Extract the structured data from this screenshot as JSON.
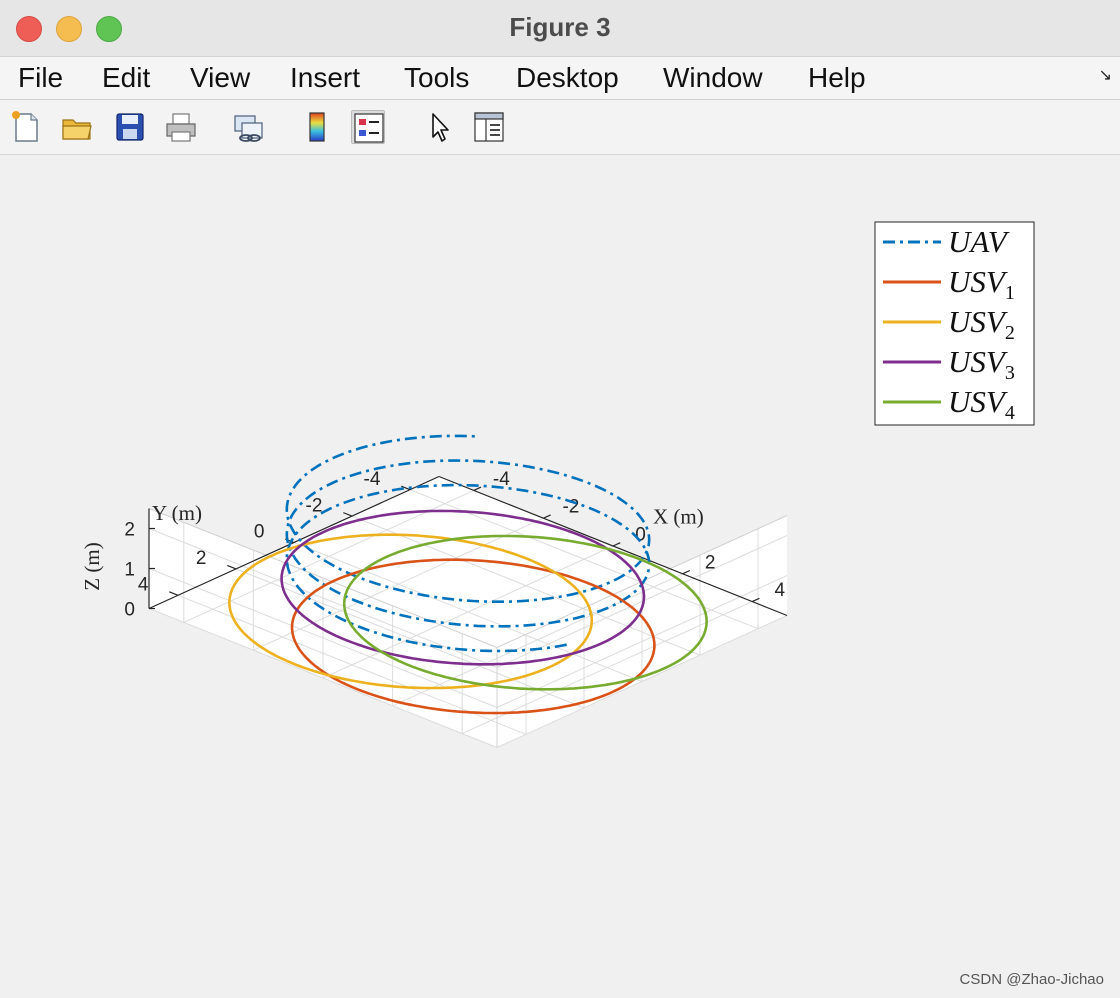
{
  "window": {
    "title": "Figure 3"
  },
  "menu": {
    "items": [
      "File",
      "Edit",
      "View",
      "Insert",
      "Tools",
      "Desktop",
      "Window",
      "Help"
    ]
  },
  "toolbar": {
    "icons": [
      "new-figure-icon",
      "open-file-icon",
      "save-icon",
      "print-icon",
      "link-plot-icon",
      "insert-colorbar-icon",
      "insert-legend-icon",
      "edit-plot-icon",
      "property-inspector-icon"
    ]
  },
  "watermark": "CSDN @Zhao-Jichao",
  "colors": {
    "UAV": "#0072BD",
    "USV1": "#D95319",
    "USV2": "#EDB120",
    "USV3": "#7E2F8E",
    "USV4": "#77AC30"
  },
  "chart_data": {
    "type": "line",
    "projection": "3d",
    "title": "",
    "xlabel": "X (m)",
    "ylabel": "Y (m)",
    "zlabel": "Z (m)",
    "xticks": [
      -4,
      -2,
      0,
      2,
      4
    ],
    "yticks": [
      -4,
      -2,
      0,
      2,
      4
    ],
    "zticks": [
      0,
      1,
      2
    ],
    "xlim": [
      -5,
      5
    ],
    "ylim": [
      -5,
      5
    ],
    "zlim": [
      0,
      2.5
    ],
    "grid": true,
    "legend_position": "top-right",
    "legend": [
      {
        "base": "UAV",
        "sub": ""
      },
      {
        "base": "USV",
        "sub": "1"
      },
      {
        "base": "USV",
        "sub": "2"
      },
      {
        "base": "USV",
        "sub": "3"
      },
      {
        "base": "USV",
        "sub": "4"
      }
    ],
    "series": [
      {
        "name": "UAV",
        "style": "dash-dot",
        "path": "spiral",
        "radius": 4,
        "z_start": 0.9,
        "z_end": 2.5,
        "turns": 2.6
      },
      {
        "name": "USV1",
        "style": "solid",
        "path": "circle",
        "radius": 4,
        "center": [
          0.9,
          0.9
        ],
        "z": 0
      },
      {
        "name": "USV2",
        "style": "solid",
        "path": "circle",
        "radius": 4,
        "center": [
          -0.9,
          0.9
        ],
        "z": 0
      },
      {
        "name": "USV3",
        "style": "solid",
        "path": "circle",
        "radius": 4,
        "center": [
          -0.9,
          -0.9
        ],
        "z": 0
      },
      {
        "name": "USV4",
        "style": "solid",
        "path": "circle",
        "radius": 4,
        "center": [
          0.9,
          -0.9
        ],
        "z": 0
      }
    ]
  }
}
